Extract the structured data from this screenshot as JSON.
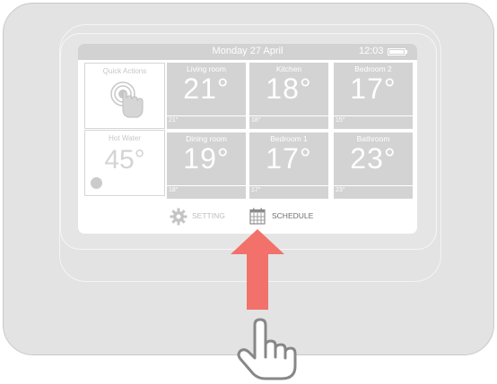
{
  "header": {
    "date": "Monday 27 April",
    "time": "12:03",
    "battery_icon": "battery-full-icon"
  },
  "quick_actions": {
    "label": "Quick Actions",
    "icon": "touch-hand-icon"
  },
  "hot_water": {
    "label": "Hot Water",
    "temp": "45°"
  },
  "rooms": [
    {
      "name": "Living room",
      "temp": "21°",
      "setpoint": "21°"
    },
    {
      "name": "Kitchen",
      "temp": "18°",
      "setpoint": "18°"
    },
    {
      "name": "Bedroom 2",
      "temp": "17°",
      "setpoint": "15°"
    },
    {
      "name": "Dining room",
      "temp": "19°",
      "setpoint": "18°"
    },
    {
      "name": "Bedroom 1",
      "temp": "17°",
      "setpoint": "17°"
    },
    {
      "name": "Bathroom",
      "temp": "23°",
      "setpoint": "23°"
    }
  ],
  "nav": {
    "setting": {
      "label": "SETTING",
      "icon": "gear-icon"
    },
    "schedule": {
      "label": "SCHEDULE",
      "icon": "calendar-icon"
    }
  },
  "colors": {
    "tile": "#d3d3d3",
    "arrow": "#f2716b",
    "device": "#e3e3e3"
  }
}
